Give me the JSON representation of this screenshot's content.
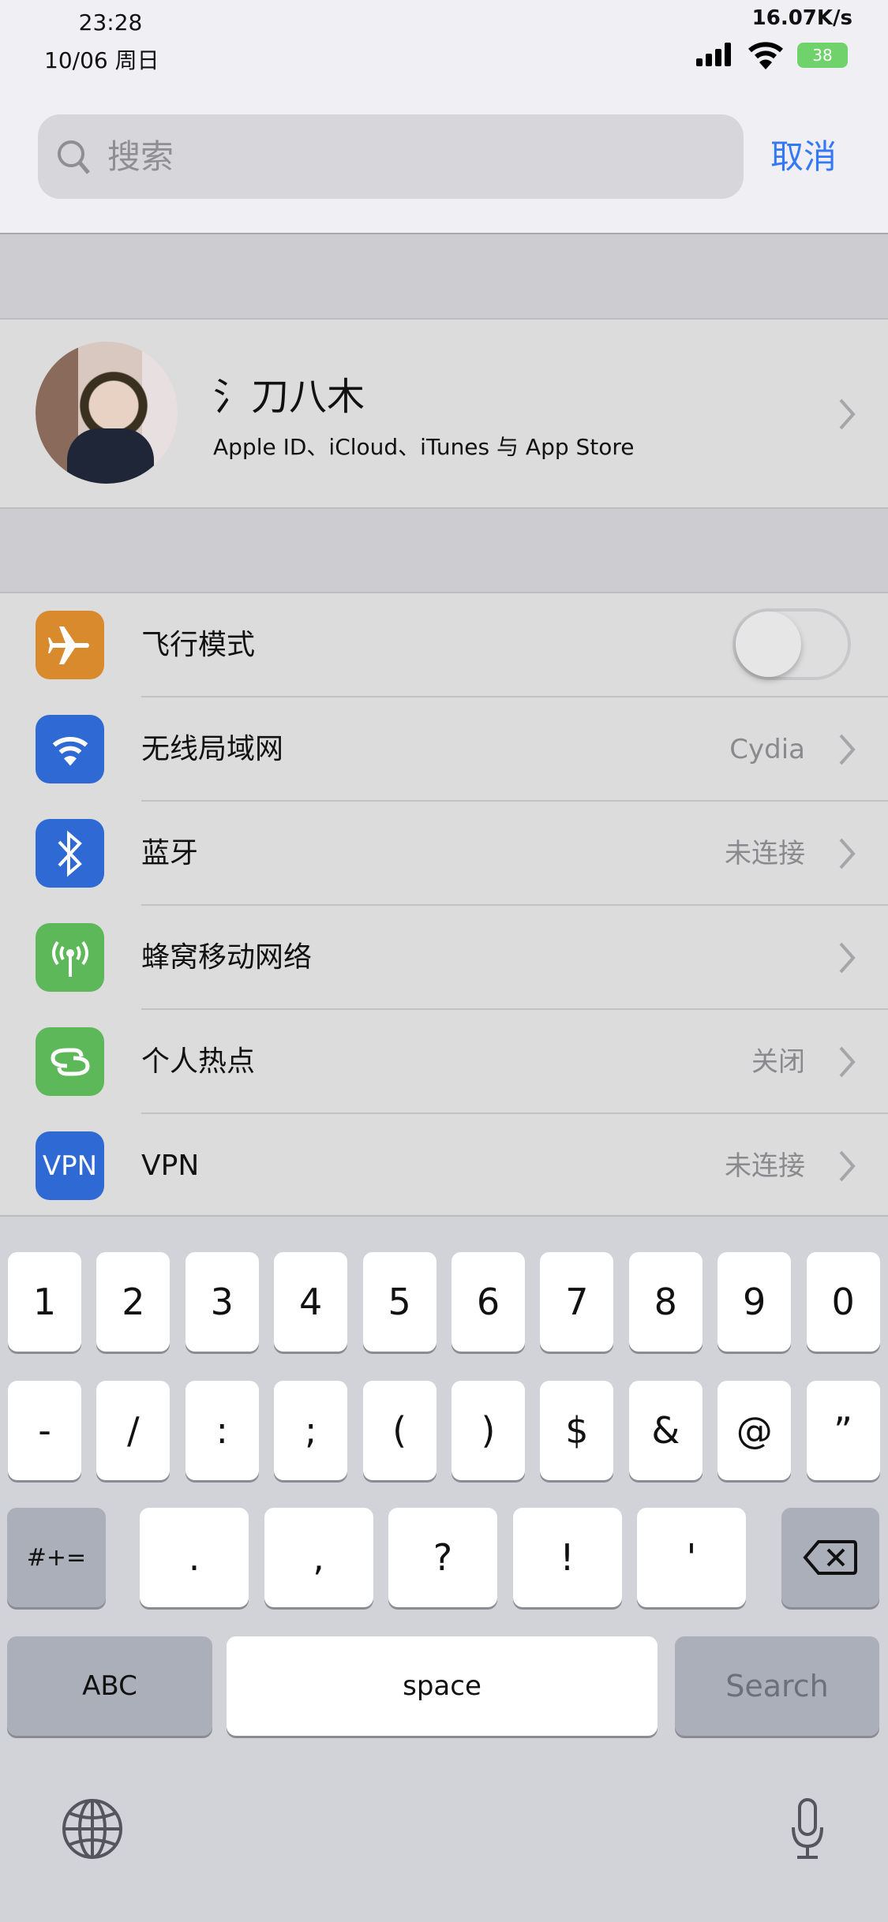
{
  "status_bar": {
    "time": "23:28",
    "date": "10/06 周日",
    "net_speed": "16.07K/s",
    "battery": "38",
    "battery_color": "#6fd26a"
  },
  "search": {
    "placeholder": "搜索",
    "cancel_label": "取消",
    "accent": "#3478f6"
  },
  "profile": {
    "name": "氵刀八木",
    "subtitle": "Apple ID、iCloud、iTunes 与 App Store"
  },
  "settings": [
    {
      "label": "飞行模式",
      "icon": "airplane-icon",
      "color": "#d88a2c",
      "toggle": false
    },
    {
      "label": "无线局域网",
      "icon": "wifi-icon",
      "color": "#2f6ad4",
      "value": "Cydia"
    },
    {
      "label": "蓝牙",
      "icon": "bluetooth-icon",
      "color": "#2f6ad4",
      "value": "未连接"
    },
    {
      "label": "蜂窝移动网络",
      "icon": "cellular-icon",
      "color": "#5db85a",
      "value": ""
    },
    {
      "label": "个人热点",
      "icon": "hotspot-icon",
      "color": "#5db85a",
      "value": "关闭"
    },
    {
      "label": "VPN",
      "icon": "vpn-icon",
      "color": "#2f6ad4",
      "icon_text": "VPN",
      "value": "未连接"
    }
  ],
  "keyboard": {
    "row1": [
      "1",
      "2",
      "3",
      "4",
      "5",
      "6",
      "7",
      "8",
      "9",
      "0"
    ],
    "row2": [
      "-",
      "/",
      ":",
      ";",
      "(",
      ")",
      "$",
      "&",
      "@",
      "”"
    ],
    "row3": [
      ".",
      ",",
      "?",
      "!",
      "'"
    ],
    "symbols_label": "#+=",
    "abc_label": "ABC",
    "space_label": "space",
    "search_label": "Search"
  }
}
